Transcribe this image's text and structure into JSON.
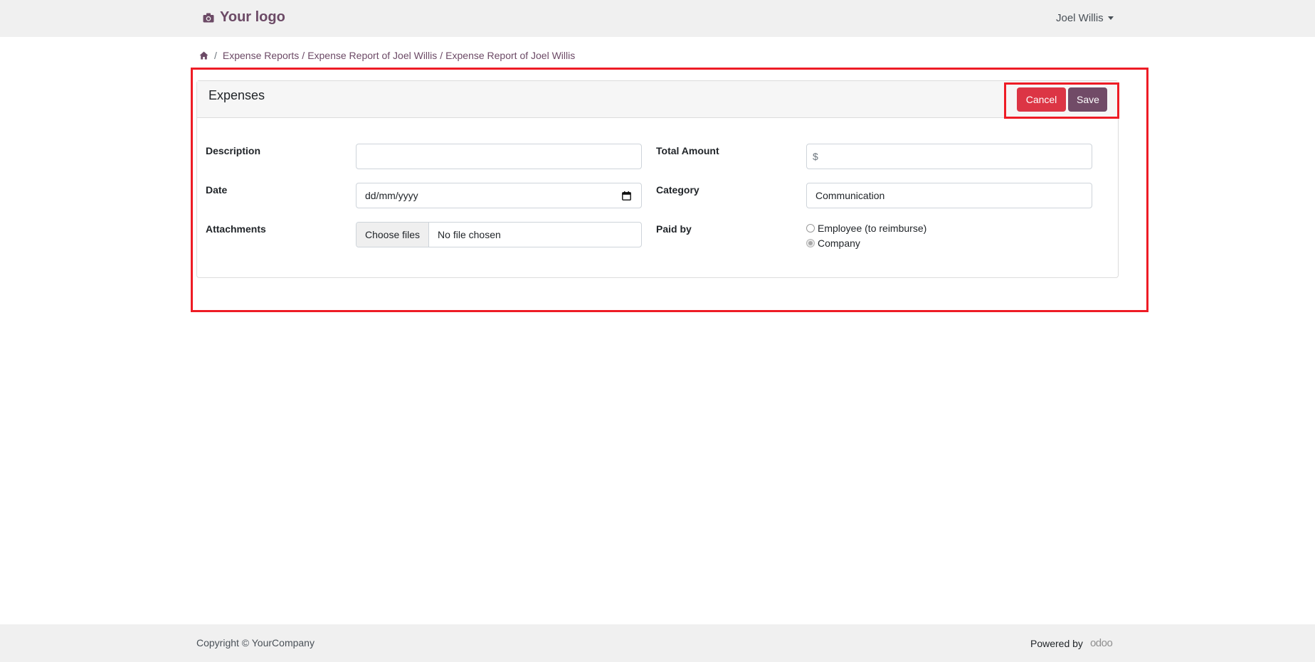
{
  "header": {
    "logo_text": "Your logo",
    "user_name": "Joel Willis"
  },
  "breadcrumb": {
    "separator": "/",
    "items": [
      "Expense Reports",
      "Expense Report of Joel Willis"
    ],
    "current": "Expense Report of Joel Willis"
  },
  "card": {
    "title": "Expenses",
    "cancel_label": "Cancel",
    "save_label": "Save"
  },
  "form": {
    "description_label": "Description",
    "description_value": "",
    "date_label": "Date",
    "date_placeholder": "dd/mm/yyyy",
    "attachments_label": "Attachments",
    "choose_files_label": "Choose files",
    "file_status": "No file chosen",
    "total_amount_label": "Total Amount",
    "currency_symbol": "$",
    "category_label": "Category",
    "category_value": "Communication",
    "paid_by_label": "Paid by",
    "paid_by_options": [
      "Employee (to reimburse)",
      "Company"
    ],
    "paid_by_selected": "Company"
  },
  "footer": {
    "copyright": "Copyright © YourCompany",
    "powered_by": "Powered by",
    "powered_brand": "odoo"
  },
  "colors": {
    "brand": "#714b67",
    "danger": "#dc3545",
    "highlight": "#ee1c25"
  }
}
